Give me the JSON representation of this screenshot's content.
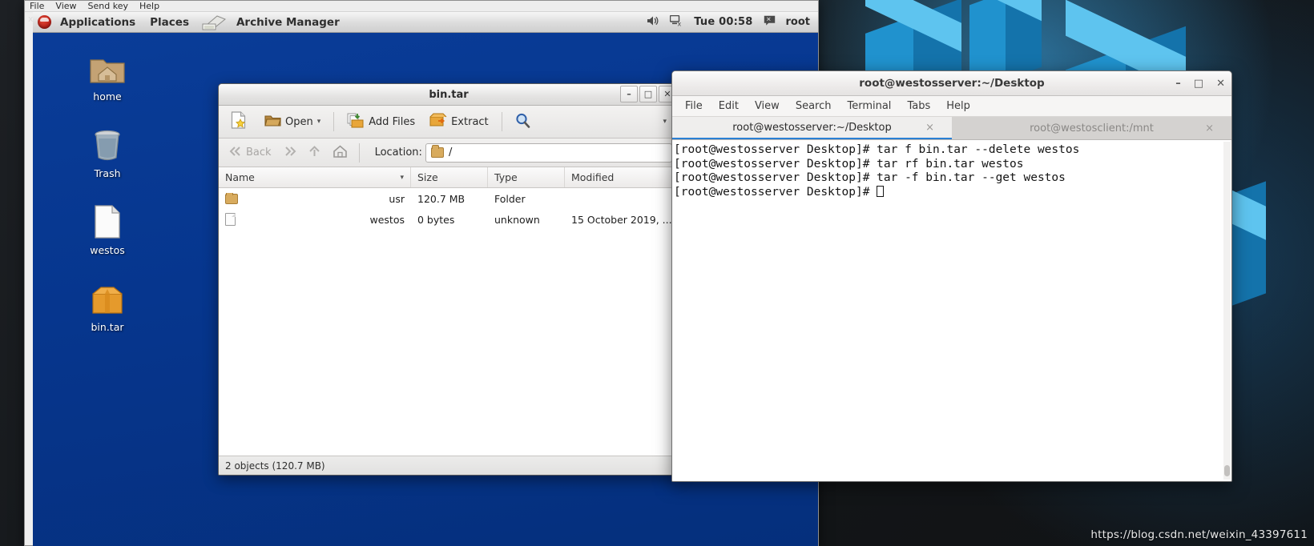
{
  "vm_window": {
    "menu_items": [
      "File",
      "View",
      "Send key",
      "Help"
    ],
    "close_label": "x"
  },
  "panel": {
    "logo": "redhat-logo",
    "applications": "Applications",
    "places": "Places",
    "active_app": "Archive Manager",
    "volume_icon": "volume-icon",
    "network_icon": "network-disconnected-icon",
    "clock": "Tue 00:58",
    "user_icon": "user-status-icon",
    "user": "root"
  },
  "desktop_icons": [
    {
      "name": "home",
      "icon": "home-folder-icon"
    },
    {
      "name": "Trash",
      "icon": "trash-icon"
    },
    {
      "name": "westos",
      "icon": "text-file-icon"
    },
    {
      "name": "bin.tar",
      "icon": "archive-icon"
    }
  ],
  "archive_manager": {
    "title": "bin.tar",
    "window_buttons": {
      "minimize": "–",
      "maximize": "□",
      "close": "✕"
    },
    "toolbar": {
      "new_label": "",
      "new_icon": "new-archive-icon",
      "open_label": "Open",
      "open_icon": "open-folder-icon",
      "open_caret": "▾",
      "add_files_label": "Add Files",
      "add_files_icon": "add-files-icon",
      "extract_label": "Extract",
      "extract_icon": "extract-icon",
      "search_icon": "search-icon",
      "menu_caret": "▾"
    },
    "locationbar": {
      "back_label": "Back",
      "back_icon": "back-arrow-icon",
      "forward_icon": "forward-arrow-icon",
      "up_icon": "up-arrow-icon",
      "home_icon": "home-icon",
      "location_label": "Location:",
      "location_value": "/",
      "location_icon": "folder-icon"
    },
    "columns": [
      "Name",
      "Size",
      "Type",
      "Modified"
    ],
    "sort_caret": "▾",
    "rows": [
      {
        "icon": "folder-icon",
        "name": "usr",
        "size": "120.7 MB",
        "type": "Folder",
        "modified": ""
      },
      {
        "icon": "file-icon",
        "name": "westos",
        "size": "0 bytes",
        "type": "unknown",
        "modified": "15 October 2019, ..."
      }
    ],
    "status": "2 objects (120.7 MB)"
  },
  "terminal": {
    "title": "root@westosserver:~/Desktop",
    "window_buttons": {
      "minimize": "–",
      "maximize": "□",
      "close": "✕"
    },
    "menu": [
      "File",
      "Edit",
      "View",
      "Search",
      "Terminal",
      "Tabs",
      "Help"
    ],
    "tabs": [
      {
        "label": "root@westosserver:~/Desktop",
        "active": true,
        "close": "×"
      },
      {
        "label": "root@westosclient:/mnt",
        "active": false,
        "close": "×"
      }
    ],
    "prompt": "[root@westosserver Desktop]# ",
    "lines": [
      "[root@westosserver Desktop]# tar f bin.tar --delete westos",
      "[root@westosserver Desktop]# tar rf bin.tar westos",
      "[root@westosserver Desktop]# tar -f bin.tar --get westos"
    ],
    "last_prompt": "[root@westosserver Desktop]# "
  },
  "watermark": "https://blog.csdn.net/weixin_43397611",
  "colors": {
    "desktop_blue": "#06368e",
    "panel_bg": "#dcdcdc",
    "tab_accent": "#2a7fd4",
    "terminal_bg": "#ffffff",
    "terminal_fg": "#151515"
  }
}
